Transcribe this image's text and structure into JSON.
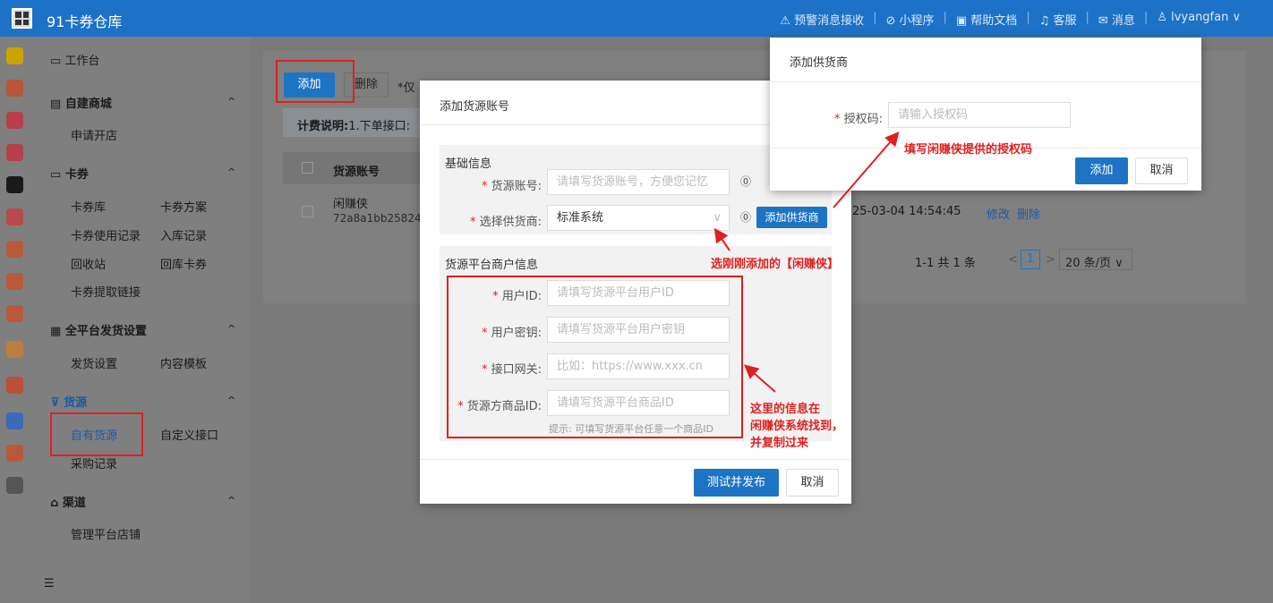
{
  "app": {
    "title": "91卡券仓库"
  },
  "topnav": {
    "alerts": "⚠ 预警消息接收",
    "miniapp": "⊘ 小程序",
    "docs": "▣ 帮助文档",
    "service": "♫ 客服",
    "messages": "✉ 消息",
    "user": "♙ lvyangfan ∨"
  },
  "sidebar": {
    "workbench": "工作台",
    "mall": "自建商城",
    "mall_open": "申请开店",
    "coupons": "卡券",
    "coupon_lib": "卡券库",
    "coupon_plan": "卡券方案",
    "coupon_use": "卡券使用记录",
    "coupon_in": "入库记录",
    "recycle": "回收站",
    "back_coupon": "回库卡券",
    "coupon_link": "卡券提取链接",
    "ship": "全平台发货设置",
    "ship_settings": "发货设置",
    "content_tpl": "内容模板",
    "source": "货源",
    "own_source": "自有货源",
    "custom_api": "自定义接口",
    "purchase": "采购记录",
    "channel": "渠道",
    "manage_shops": "管理平台店铺"
  },
  "toolbar": {
    "add": "添加",
    "delete": "删除",
    "note": "*仅"
  },
  "billing": {
    "label": "计费说明:",
    "text": "1.下单接口:"
  },
  "table": {
    "header_account": "货源账号",
    "row_name": "闲赚侠",
    "row_id": "72a8a1bb25824c",
    "row_time": "25-03-04 14:54:45",
    "edit": "修改",
    "remove": "删除"
  },
  "pagination": {
    "total": "1-1 共 1 条",
    "prev": "<",
    "page": "1",
    "next": ">",
    "size": "20 条/页 ∨"
  },
  "dialog_source": {
    "title": "添加货源账号",
    "basic": "基础信息",
    "account_label": "货源账号:",
    "account_ph": "请填写货源账号，方便您记忆",
    "supplier_label": "选择供货商:",
    "supplier_value": "标准系统",
    "add_supplier": "添加供货商",
    "merchant": "货源平台商户信息",
    "userid_label": "用户ID:",
    "userid_ph": "请填写货源平台用户ID",
    "secret_label": "用户密钥:",
    "secret_ph": "请填写货源平台用户密钥",
    "gateway_label": "接口网关:",
    "gateway_ph": "比如：https://www.xxx.cn",
    "goods_label": "货源方商品ID:",
    "goods_ph": "请填写货源平台商品ID",
    "hint": "提示: 可填写货源平台任意一个商品ID",
    "submit": "测试并发布",
    "cancel": "取消"
  },
  "dialog_supplier": {
    "title": "添加供货商",
    "auth_label": "授权码:",
    "auth_ph": "请输入授权码",
    "add": "添加",
    "cancel": "取消"
  },
  "annotations": {
    "auth": "填写闲赚侠提供的授权码",
    "choose": "选刚刚添加的【闲赚侠】",
    "info1": "这里的信息在",
    "info2": "闲赚侠系统找到，",
    "info3": "并复制过来"
  },
  "colors": {
    "primary": "#1e74c4",
    "annotation": "#e02020"
  }
}
